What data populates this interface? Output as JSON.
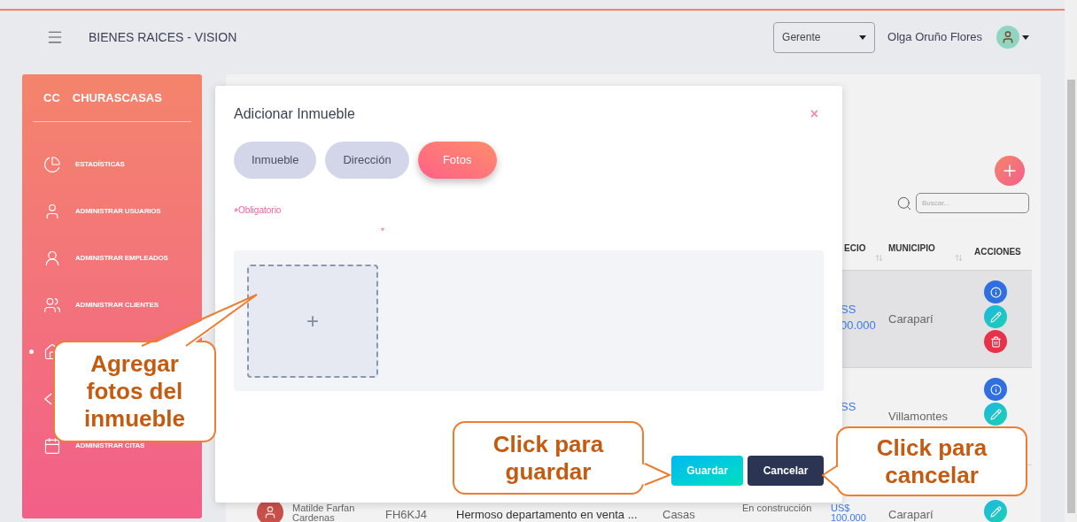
{
  "header": {
    "title": "BIENES RAICES - VISION",
    "role_select": {
      "value": "Gerente"
    },
    "user_name": "Olga Oruño Flores"
  },
  "sidebar": {
    "brand_initials": "CC",
    "brand_name": "CHURASCASAS",
    "items": [
      {
        "kind": "chart",
        "label": "ESTADÍSTICAS",
        "selected": false
      },
      {
        "kind": "user",
        "label": "ADMINISTRAR USUARIOS",
        "selected": false
      },
      {
        "kind": "employee",
        "label": "ADMINISTRAR EMPLEADOS",
        "selected": false
      },
      {
        "kind": "clients",
        "label": "ADMINISTRAR CLIENTES",
        "selected": false
      },
      {
        "kind": "house",
        "selected": true
      },
      {
        "kind": "swap",
        "selected": false
      },
      {
        "kind": "calendar",
        "label": "ADMINISTRAR CITAS",
        "selected": false
      }
    ]
  },
  "search": {
    "placeholder": "Buscar..."
  },
  "table": {
    "columns": [
      "ECIO",
      "MUNICIPIO",
      "ACCIONES"
    ],
    "rows": [
      {
        "highlighted": true,
        "price": [
          "SS",
          "00.000"
        ],
        "municipio": "Caraparí",
        "actions": [
          {
            "kind": "info"
          },
          {
            "kind": "edit"
          },
          {
            "kind": "delete"
          }
        ]
      },
      {
        "highlighted": false,
        "price": [
          "SS"
        ],
        "municipio": "Villamontes",
        "actions": [
          {
            "kind": "info"
          },
          {
            "kind": "edit"
          }
        ]
      },
      {
        "highlighted": false,
        "name": "Matilde Farfan Cardenas",
        "code": "FH6KJ4",
        "description": "Hermoso departamento en venta ...",
        "type": "Casas",
        "status": "En construcción",
        "price": [
          "US$",
          "100.000"
        ],
        "municipio": "Caraparí",
        "actions": [
          {
            "kind": "edit"
          }
        ]
      }
    ]
  },
  "modal": {
    "title": "Adicionar Inmueble",
    "close": "×",
    "tabs": [
      {
        "label": "Inmueble",
        "selected": false
      },
      {
        "label": "Dirección",
        "selected": false
      },
      {
        "label": "Fotos",
        "selected": true
      }
    ],
    "required_mark": "*",
    "required_note": "Obligatorio",
    "field_mark": "*",
    "upload_plus": "+",
    "buttons": [
      {
        "kind": "save",
        "label": "Guardar"
      },
      {
        "kind": "cancel",
        "label": "Cancelar"
      }
    ]
  },
  "callouts": [
    {
      "kind": "photos",
      "text": "Agregar fotos del inmueble"
    },
    {
      "kind": "save",
      "text": "Click para guardar"
    },
    {
      "kind": "cancel",
      "text": "Click para cancelar"
    }
  ]
}
